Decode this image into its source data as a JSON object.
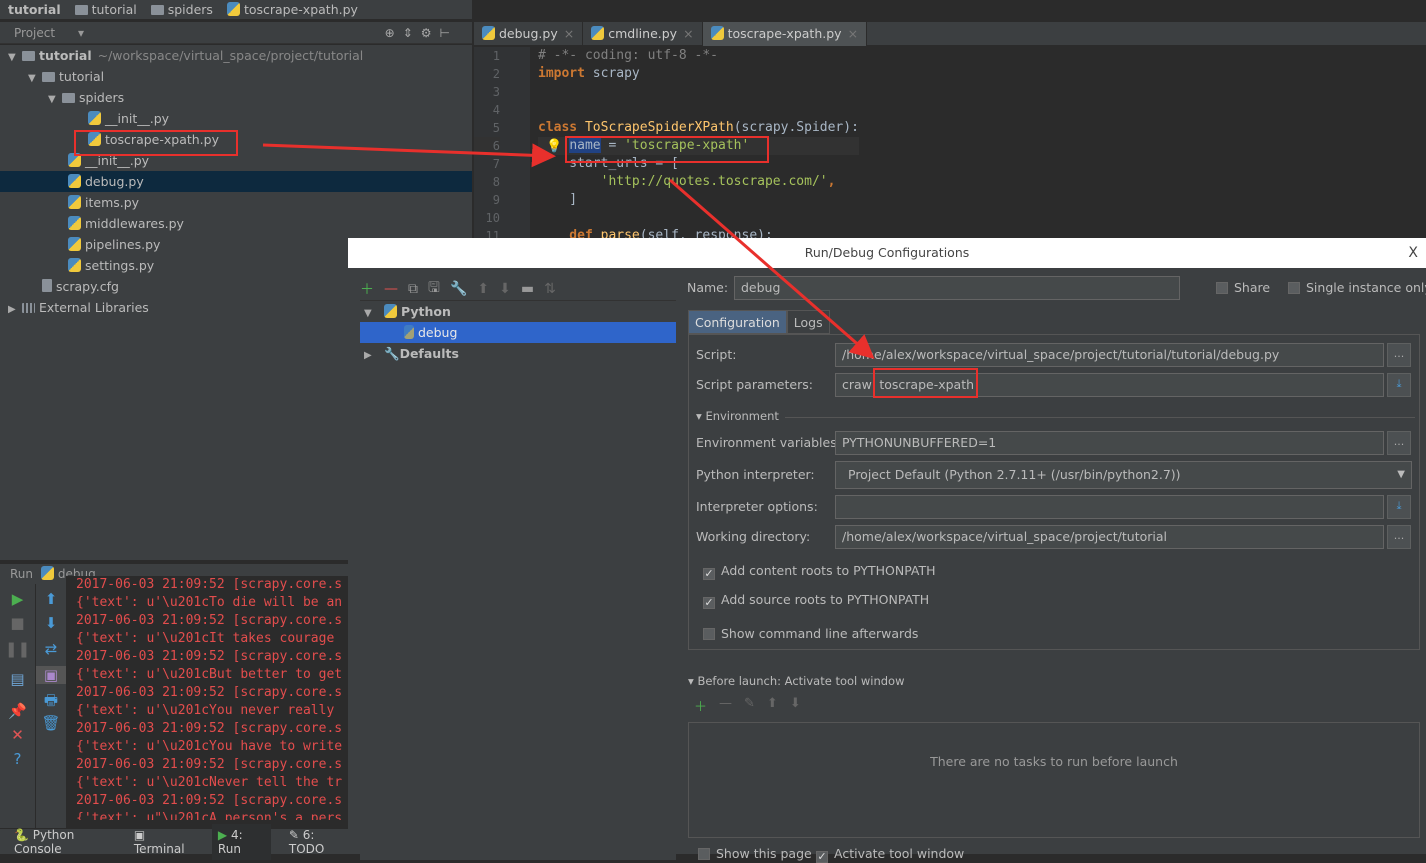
{
  "breadcrumb": [
    "tutorial",
    "tutorial",
    "spiders",
    "toscrape-xpath.py"
  ],
  "project_panel": {
    "title": "Project",
    "tree": [
      {
        "label": "tutorial",
        "extra": "~/workspace/virtual_space/project/tutorial",
        "type": "folder",
        "depth": 0,
        "expanded": true,
        "bold": true
      },
      {
        "label": "tutorial",
        "type": "folder",
        "depth": 1,
        "expanded": true
      },
      {
        "label": "spiders",
        "type": "folder",
        "depth": 2,
        "expanded": true
      },
      {
        "label": "__init__.py",
        "type": "py",
        "depth": 3
      },
      {
        "label": "toscrape-xpath.py",
        "type": "py",
        "depth": 3,
        "highlighted": true
      },
      {
        "label": "__init__.py",
        "type": "py",
        "depth": 2
      },
      {
        "label": "debug.py",
        "type": "py",
        "depth": 2,
        "selected": true
      },
      {
        "label": "items.py",
        "type": "py",
        "depth": 2
      },
      {
        "label": "middlewares.py",
        "type": "py",
        "depth": 2
      },
      {
        "label": "pipelines.py",
        "type": "py",
        "depth": 2
      },
      {
        "label": "settings.py",
        "type": "py",
        "depth": 2
      },
      {
        "label": "scrapy.cfg",
        "type": "cfg",
        "depth": 1
      },
      {
        "label": "External Libraries",
        "type": "lib",
        "depth": 0,
        "expanded": false
      }
    ]
  },
  "editor": {
    "tabs": [
      {
        "label": "debug.py"
      },
      {
        "label": "cmdline.py"
      },
      {
        "label": "toscrape-xpath.py",
        "active": true
      }
    ],
    "line_numbers": [
      "1",
      "2",
      "3",
      "4",
      "5",
      "6",
      "7",
      "8",
      "9",
      "10",
      "11"
    ],
    "lines": [
      [
        {
          "t": "# -*- coding: utf-8 -*-",
          "c": "cm"
        }
      ],
      [
        {
          "t": "import",
          "c": "kw"
        },
        {
          "t": " scrapy",
          "c": ""
        }
      ],
      [],
      [],
      [
        {
          "t": "class",
          "c": "kw"
        },
        {
          "t": " ToScrapeSpiderXPath",
          "c": "fn"
        },
        {
          "t": "(scrapy.Spider):",
          "c": ""
        }
      ],
      [
        {
          "t": "    ",
          "c": ""
        },
        {
          "t": "name",
          "c": "hl"
        },
        {
          "t": " = ",
          "c": ""
        },
        {
          "t": "'toscrape-xpath'",
          "c": "st"
        }
      ],
      [
        {
          "t": "    start_urls = [",
          "c": ""
        }
      ],
      [
        {
          "t": "        ",
          "c": ""
        },
        {
          "t": "'http://quotes.toscrape.com/'",
          "c": "st"
        },
        {
          "t": ",",
          "c": "kw"
        }
      ],
      [
        {
          "t": "    ]",
          "c": ""
        }
      ],
      [],
      [
        {
          "t": "    def",
          "c": "kw"
        },
        {
          "t": " parse",
          "c": "fn"
        },
        {
          "t": "(self, response):",
          "c": ""
        }
      ]
    ]
  },
  "run_panel": {
    "title": "Run",
    "config": "debug",
    "lines": [
      "2017-06-03 21:09:52 [scrapy.core.s",
      "{'text': u'\\u201cTo die will be an",
      "2017-06-03 21:09:52 [scrapy.core.s",
      "{'text': u'\\u201cIt takes courage ",
      "2017-06-03 21:09:52 [scrapy.core.s",
      "{'text': u'\\u201cBut better to get",
      "2017-06-03 21:09:52 [scrapy.core.s",
      "{'text': u'\\u201cYou never really ",
      "2017-06-03 21:09:52 [scrapy.core.s",
      "{'text': u'\\u201cYou have to write",
      "2017-06-03 21:09:52 [scrapy.core.s",
      "{'text': u'\\u201cNever tell the tr",
      "2017-06-03 21:09:52 [scrapy.core.s",
      "{'text': u\"\\u201cA person's a pers"
    ]
  },
  "bottom_tabs": [
    {
      "label": "Python Console"
    },
    {
      "label": "Terminal"
    },
    {
      "label": "4: Run",
      "active": true
    },
    {
      "label": "6: TODO"
    }
  ],
  "dialog": {
    "title": "Run/Debug Configurations",
    "close": "X",
    "tree": [
      {
        "label": "Python",
        "bold": true
      },
      {
        "label": "debug",
        "selected": true
      },
      {
        "label": "Defaults",
        "bold": true
      }
    ],
    "name_label": "Name:",
    "name_value": "debug",
    "share": "Share",
    "single_instance": "Single instance only",
    "tabs": [
      "Configuration",
      "Logs"
    ],
    "script_label": "Script:",
    "script_value": "/home/alex/workspace/virtual_space/project/tutorial/tutorial/debug.py",
    "params_label": "Script parameters:",
    "params_value": "crawl toscrape-xpath",
    "environment": "Environment",
    "env_label": "Environment variables:",
    "env_value": "PYTHONUNBUFFERED=1",
    "interp_label": "Python interpreter:",
    "interp_value": "Project Default (Python 2.7.11+ (/usr/bin/python2.7))",
    "interp_opts_label": "Interpreter options:",
    "interp_opts_value": "",
    "workdir_label": "Working directory:",
    "workdir_value": "/home/alex/workspace/virtual_space/project/tutorial",
    "add_content_roots": "Add content roots to PYTHONPATH",
    "add_content_roots_checked": true,
    "add_source_roots": "Add source roots to PYTHONPATH",
    "add_source_roots_checked": true,
    "show_cmdline": "Show command line afterwards",
    "show_cmdline_checked": false,
    "before_launch": "Before launch: Activate tool window",
    "no_tasks": "There are no tasks to run before launch",
    "show_page": "Show this page",
    "show_page_checked": false,
    "activate_tool": "Activate tool window",
    "activate_tool_checked": true
  },
  "annotation_color": "#e8302c"
}
